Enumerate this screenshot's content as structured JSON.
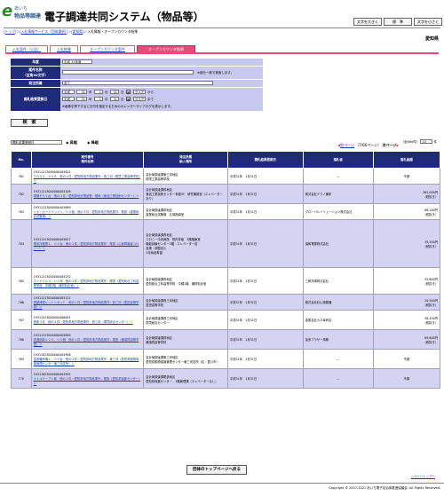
{
  "header": {
    "logo_letter": "e",
    "logo_line1": "あいち",
    "logo_line2": "物品等調達",
    "title": "電子調達共同システム（物品等）",
    "buttons": [
      "文字を大きく",
      "標　準",
      "文字を小さく"
    ]
  },
  "breadcrumb": [
    "トップ",
    "入札情報サービス（団体選択）",
    "愛知県",
    "入札情報・オープンカウンタ結果"
  ],
  "organization": "愛知県",
  "tabs": [
    "入札案件（公告）",
    "入札結果",
    "オープンカウンタ案件",
    "オープンカウンタ結果"
  ],
  "search_form": {
    "year_label": "年度",
    "year_value": "平成 31年度",
    "name_label": "案件名称\n（全角50文字）",
    "name_hint": "※部分一致で検索します。",
    "dept_label": "発注所属",
    "dept_value": "全て",
    "date_label": "開札結果登録日",
    "era": "平成",
    "from": {
      "year": "31",
      "month": "1",
      "day": "31"
    },
    "to": {
      "year": "31",
      "month": "1",
      "day": "31"
    },
    "year_unit": "年",
    "month_unit": "月",
    "day_unit": "日",
    "clear_label": "クリア",
    "from_label": "から",
    "to_label": "まで",
    "date_hint": "※画像を押下すると日付を指定するためのカレンダーダイアログを表示します。",
    "search_button": "検　索"
  },
  "sort": {
    "field": "開札結果登録日",
    "asc": "昇順",
    "desc": "降順",
    "count": "（全660件）",
    "per_page": "10",
    "per_page_unit": "件",
    "page_info": "（7/66ページ）",
    "next": "次ページ",
    "prev": "前ページ"
  },
  "table": {
    "headers": [
      "No.",
      "案件番号\n案件名称",
      "発注所属\n納入場所",
      "開札結果登録日",
      "落札者",
      "落札金額"
    ],
    "rows": [
      {
        "no": "761",
        "id": "19311213000000405622",
        "name": "クロス２，００８　他の２件／愛知県地方物品業作：西三河（環境工業高等学校）＞",
        "dept": "会計局調達課第三河地区\n環境工業高等学校",
        "date": "平成31年　1月31日",
        "winner": "—",
        "amount": "不調"
      },
      {
        "no": "762",
        "id": "19311213000000405209",
        "name": "現場そう１台　他の１件／愛知県地方物品業：現地（食品工業技術センター）＞",
        "dept": "会計局調達課県地区\n食品工業技術センター本館3F　研究機械室（エレベーターあり）",
        "date": "平成31年　1月31日",
        "winner": "株式会社テクノ東邦",
        "amount": "262,000円\n（税抜き）"
      },
      {
        "no": "763",
        "id": "19311223000000405869",
        "name": "トナーカートリッジ１，００個　他の３件／愛知県地方物品業作：尾張（農業総合試験場）＞",
        "dept": "会計局調達課県地区\n農業総合試験場　広域指導室",
        "date": "平成31年　1月31日",
        "winner": "グローバルソリューション株式会社",
        "amount": "86,100円\n（税抜き）"
      },
      {
        "no": "764",
        "id": "19311223000000405827",
        "name": "電気冷蔵庫１，００台　他の１件／愛知県地方物品業作：尾張（心身障害者コロニー）＞",
        "dept": "会計局調達課県地区\nコロニー中央病院　院内学級　3階階東室\n機能訓練センター3階　エレベーター前\n設置・調整含む\n3月納品希望",
        "date": "平成31年　1月31日",
        "winner": "協和電業株式会社",
        "amount": "39,500円\n（税抜き）"
      },
      {
        "no": "765",
        "id": "19311213000000405232",
        "name": "エンドミル４，００本　他の１件／愛知県地方物品業作：尾張（愛知総合工科高等学校　中種1階　補材料倉室）＞",
        "dept": "会計局調達課県地区\n愛知総合工科高等学校　中種1階　補材料倉室",
        "date": "平成31年　1月31日",
        "winner": "三和商事株式会社",
        "amount": "52,600円\n（税抜き）"
      },
      {
        "no": "766",
        "id": "19311213000000405222",
        "name": "振動棒型ヒットトセット　他の１件／愛知県地方物品業作：西三河（豊田高等学校）＞",
        "dept": "会計局調達課西三河地区\n豊田高等学校",
        "date": "平成31年　1月31日",
        "winner": "株式会社杉山事務器",
        "amount": "20,500円\n（税抜き）"
      },
      {
        "no": "767",
        "id": "19311223000000406001",
        "name": "長靴３足　他の４件／愛知県地方物品業作：西三河（環境総合センター）＞",
        "dept": "会計局調達課西三河地区\n環境総合センター",
        "date": "平成31年　1月31日",
        "winner": "金属会社カネ幸商店",
        "amount": "36,450円\n（税抜き）"
      },
      {
        "no": "768",
        "id": "19311223000000405890",
        "name": "洗濯用剤１２０，００個　他の１件／愛知県地方物品業作：尾張（横須賀高等学校）＞",
        "dept": "会計局調達課県地区\n横須賀高等学校",
        "date": "平成31年　1月31日",
        "winner": "加多ブラザー事務",
        "amount": "69,600円\n（税抜き）"
      },
      {
        "no": "769",
        "id": "19311823000000405906",
        "name": "温風暖房機１，００台　他の１件／愛知県地方物品業作：東三河（愛知県動物保護管理センター東三河支所）＞",
        "dept": "会計局調達課第三河地区\n愛知県動物保護管理センター東三河支所（住：豊川市）",
        "date": "平成31年　1月31日",
        "winner": "—",
        "amount": "不調"
      },
      {
        "no": "770",
        "id": "19311823000000404992",
        "name": "ナトルテープ１個　他の２件／愛知県地方物品業作：尾張（愛知県保健センター）＞",
        "dept": "会計局調達課尾張地区\n愛知県保健センター　1階管理課（エレベーターなし）",
        "date": "平成31年　1月31日",
        "winner": "—",
        "amount": "不調"
      }
    ]
  },
  "back_button": "団体のトップページへ戻る",
  "to_top": "△ページトップへ",
  "copyright": "Copyright © 2007-2021 あいち電子自治体推進協議会. All Rights Reserved."
}
